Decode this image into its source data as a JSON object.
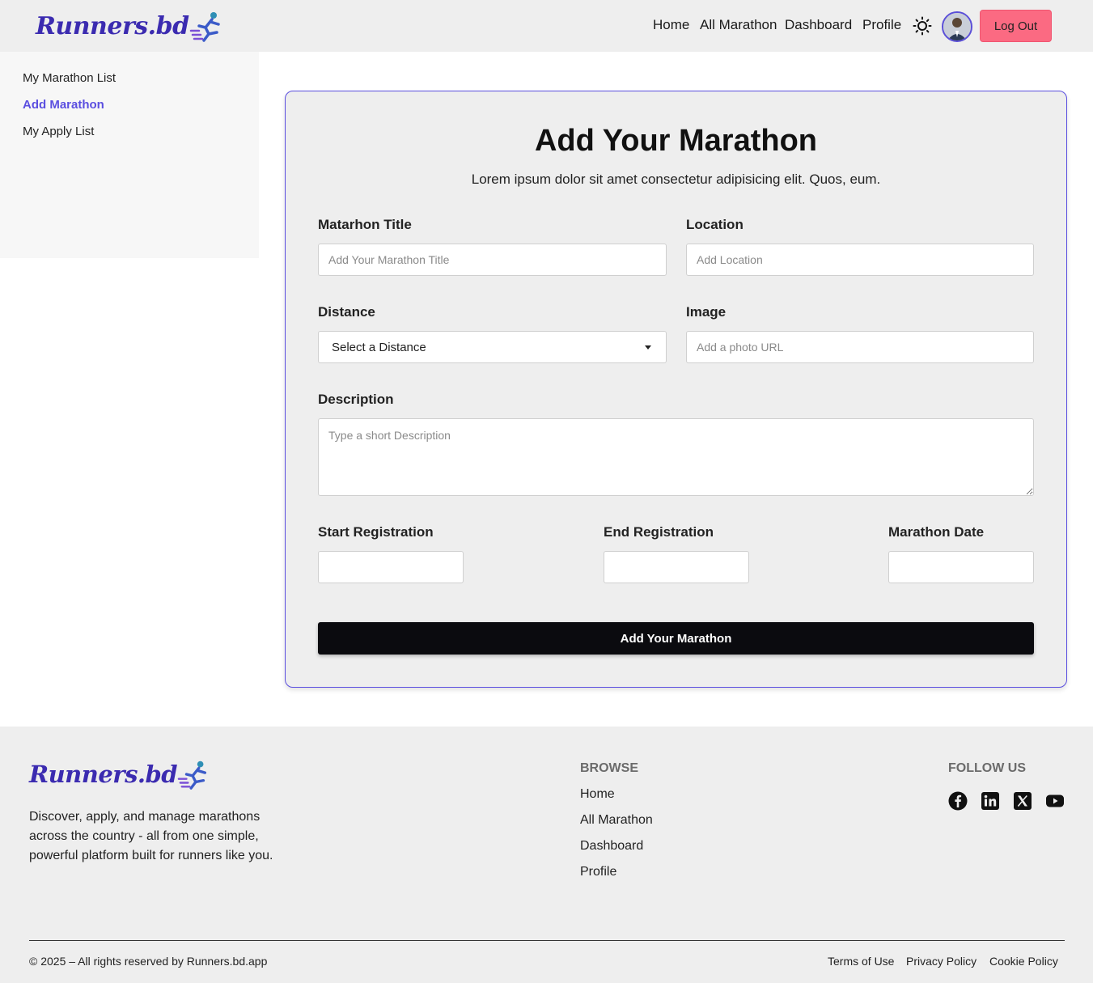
{
  "brand": {
    "logo_text": "Runners.bd"
  },
  "nav": {
    "home": "Home",
    "all_marathon": "All Marathon",
    "dashboard": "Dashboard",
    "profile": "Profile",
    "logout": "Log Out",
    "theme_icon": "sun-icon"
  },
  "sidebar": {
    "items": [
      {
        "label": "My Marathon List",
        "active": false
      },
      {
        "label": "Add Marathon",
        "active": true
      },
      {
        "label": "My Apply List",
        "active": false
      }
    ]
  },
  "form": {
    "title": "Add Your Marathon",
    "subtitle": "Lorem ipsum dolor sit amet consectetur adipisicing elit. Quos, eum.",
    "marathon_title_label": "Matarhon Title",
    "marathon_title_placeholder": "Add Your Marathon Title",
    "location_label": "Location",
    "location_placeholder": "Add Location",
    "distance_label": "Distance",
    "distance_selected": "Select a Distance",
    "image_label": "Image",
    "image_placeholder": "Add a photo URL",
    "description_label": "Description",
    "description_placeholder": "Type a short Description",
    "start_registration_label": "Start Registration",
    "end_registration_label": "End Registration",
    "marathon_date_label": "Marathon Date",
    "submit_label": "Add Your Marathon"
  },
  "footer": {
    "description": "Discover, apply, and manage marathons across the country - all from one simple, powerful platform built for runners like you.",
    "browse_heading": "BROWSE",
    "browse_links": [
      "Home",
      "All Marathon",
      "Dashboard",
      "Profile"
    ],
    "follow_heading": "FOLLOW US",
    "social_icons": [
      "facebook-icon",
      "linkedin-icon",
      "x-icon",
      "youtube-icon"
    ],
    "copyright": "© 2025 – All rights reserved by Runners.bd.app",
    "legal_links": [
      "Terms of Use",
      "Privacy Policy",
      "Cookie Policy"
    ]
  },
  "colors": {
    "brand_purple": "#3b2bb0",
    "accent": "#5b4fe0",
    "logout_bg": "#fb6a82",
    "button_dark": "#0b0b0f",
    "surface": "#eeeeee"
  }
}
